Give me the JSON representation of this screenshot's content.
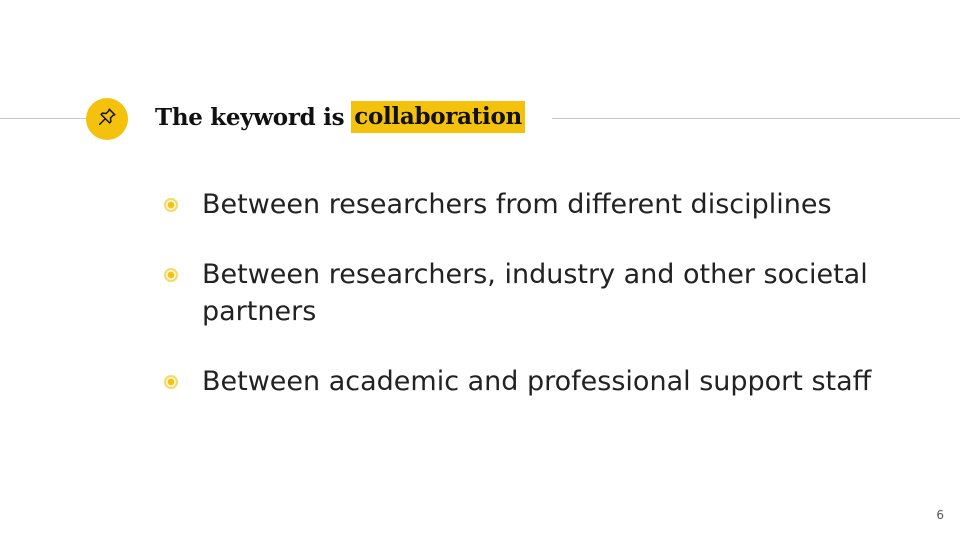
{
  "slide": {
    "title": {
      "prefix": "The keyword is",
      "highlight": "collaboration",
      "icon": "pushpin-icon"
    },
    "bullets": [
      {
        "text": "Between researchers from different disciplines"
      },
      {
        "text": "Between researchers, industry and other societal partners"
      },
      {
        "text": "Between academic and professional support staff"
      }
    ],
    "page_number": "6"
  },
  "colors": {
    "accent": "#f4c20d",
    "text": "#222222",
    "rule": "#c9c9c9"
  }
}
